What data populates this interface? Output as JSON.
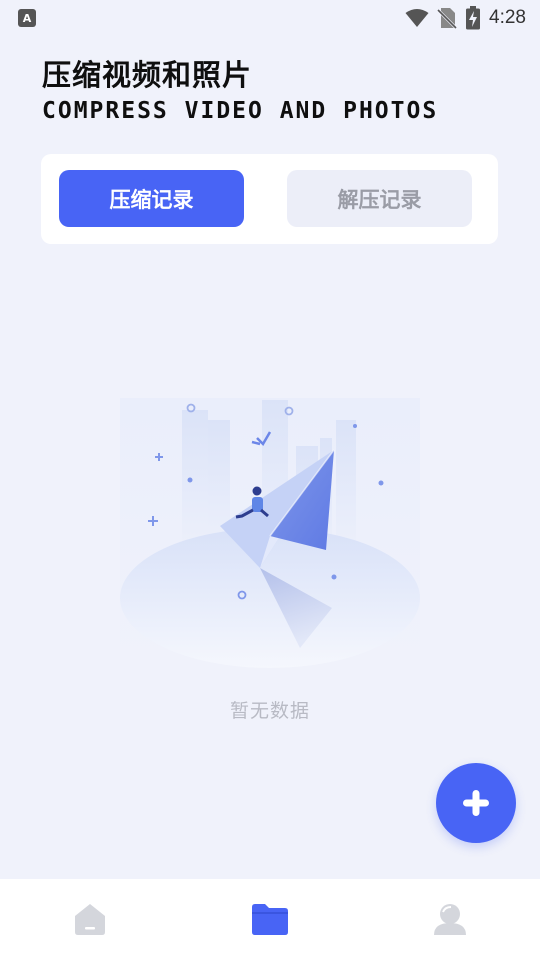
{
  "status_bar": {
    "left_icon_letter": "A",
    "time": "4:28",
    "icons": [
      "notification-a-icon",
      "wifi-icon",
      "no-sim-icon",
      "battery-charging-icon"
    ]
  },
  "header": {
    "title": "压缩视频和照片",
    "subtitle": "COMPRESS VIDEO AND PHOTOS"
  },
  "tabs": [
    {
      "label": "压缩记录",
      "active": true
    },
    {
      "label": "解压记录",
      "active": false
    }
  ],
  "empty_state": {
    "text": "暂无数据",
    "illustration": "paper-plane-empty-illustration"
  },
  "fab": {
    "icon": "plus-icon"
  },
  "bottom_nav": [
    {
      "name": "home",
      "icon": "home-icon",
      "active": false
    },
    {
      "name": "files",
      "icon": "folder-icon",
      "active": true
    },
    {
      "name": "profile",
      "icon": "user-icon",
      "active": false
    }
  ],
  "colors": {
    "accent": "#4864f5",
    "background": "#f0f2fb",
    "inactive_tab_bg": "#eceef8",
    "inactive_text": "#9a9ca6",
    "nav_inactive": "#d4d6dc"
  }
}
